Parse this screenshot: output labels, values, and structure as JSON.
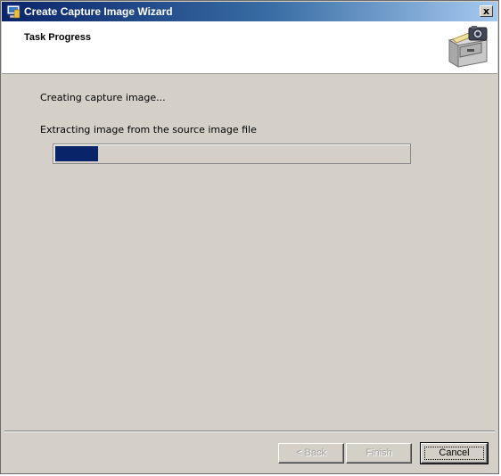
{
  "window": {
    "title": "Create Capture Image Wizard",
    "close_label": "x"
  },
  "header": {
    "title": "Task Progress",
    "icon": "filing-cabinet-camera-icon"
  },
  "main": {
    "status_line": "Creating capture image...",
    "detail_line": "Extracting image from the source image file",
    "progress": 0.12
  },
  "buttons": {
    "back": "< Back",
    "finish": "Finish",
    "cancel": "Cancel"
  },
  "colors": {
    "progress_fill": "#0a246a",
    "dialog_bg": "#d4d0c8"
  }
}
